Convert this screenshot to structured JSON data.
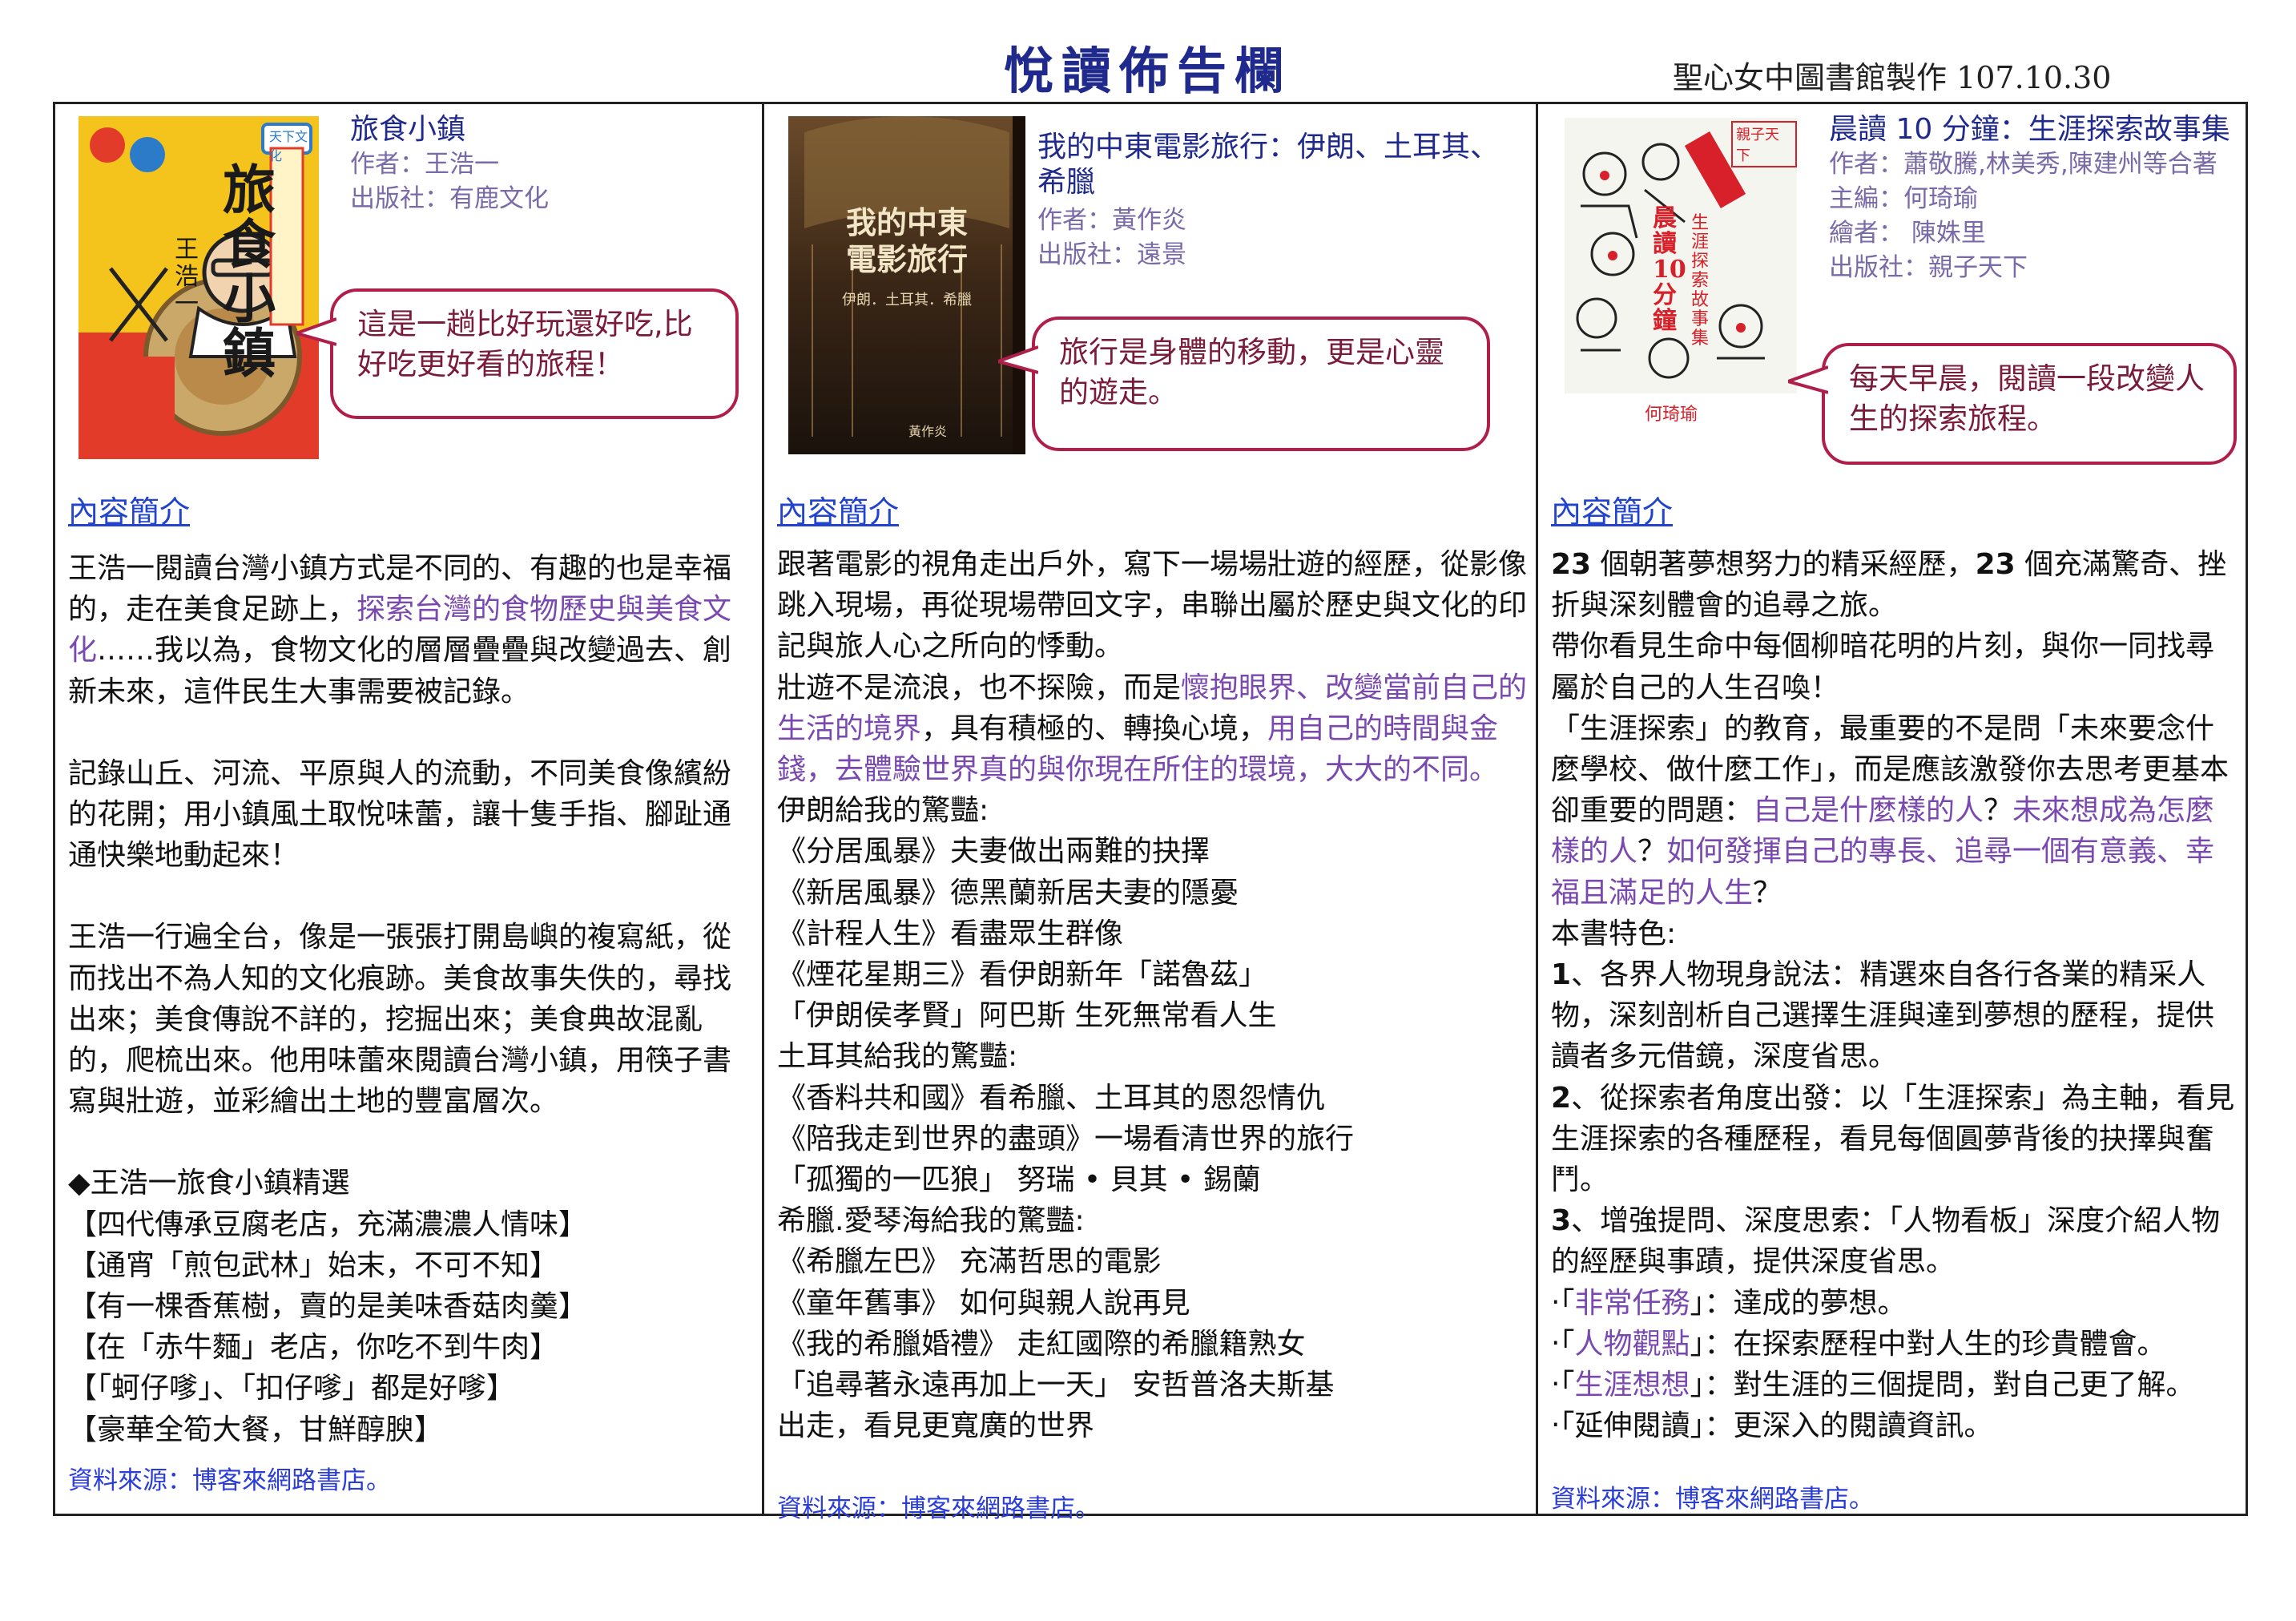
{
  "header": {
    "title": "悅讀佈告欄",
    "credit": "聖心女中圖書館製作 107.10.30"
  },
  "book1": {
    "cover": {
      "title_text": "旅食小鎮",
      "author_text": "王浩一",
      "publisher_text": "天下文化"
    },
    "title": "旅食小鎮",
    "author": "作者：王浩一",
    "publisher": "出版社：有鹿文化",
    "quote": "這是一趟比好玩還好吃,比好吃更好看的旅程！",
    "intro_label": "內容簡介",
    "body": {
      "p1a": "王浩一閱讀台灣小鎮方式是不同的、有趣的也是幸福的，走在美食足跡上，",
      "p1b": "探索台灣的食物歷史與美食文化",
      "p1c": "……我以為，食物文化的層層疊疊與改變過去、創新未來，這件民生大事需要被記錄。",
      "p2": "記錄山丘、河流、平原與人的流動，不同美食像繽紛的花開；用小鎮風土取悅味蕾，讓十隻手指、腳趾通通快樂地動起來！",
      "p3": "王浩一行遍全台，像是一張張打開島嶼的複寫紙，從而找出不為人知的文化痕跡。美食故事失佚的，尋找出來；美食傳說不詳的，挖掘出來；美食典故混亂的，爬梳出來。他用味蕾來閱讀台灣小鎮，用筷子書寫與壯遊，並彩繪出土地的豐富層次。",
      "list_title": "◆王浩一旅食小鎮精選",
      "list": [
        "【四代傳承豆腐老店，充滿濃濃人情味】",
        "【通宵「煎包武林」始末，不可不知】",
        "【有一棵香蕉樹，賣的是美味香菇肉羹】",
        "【在「赤牛麵」老店，你吃不到牛肉】",
        "【「蚵仔嗲」、「扣仔嗲」都是好嗲】",
        "【豪華全筍大餐，甘鮮醇腴】"
      ]
    },
    "source": "資料來源：博客來網路書店。"
  },
  "book2": {
    "cover": {
      "title_text": "我的中東電影旅行",
      "sub_text": "伊朗．土耳其．希臘",
      "author_text": "黃作炎"
    },
    "title": "我的中東電影旅行：伊朗、土耳其、希臘",
    "author": "作者：黃作炎",
    "publisher": "出版社：遠景",
    "quote": "旅行是身體的移動，更是心靈的遊走。",
    "intro_label": "內容簡介",
    "body": {
      "p1": "跟著電影的視角走出戶外，寫下一場場壯遊的經歷，從影像跳入現場，再從現場帶回文字，串聯出屬於歷史與文化的印記與旅人心之所向的悸動。",
      "p2a": "壯遊不是流浪，也不探險，而是",
      "p2b": "懷抱眼界、改變當前自己的生活的境界",
      "p2c": "，具有積極的、轉換心境，",
      "p2d": "用自己的時間與金錢，去體驗世界真的與你現在所住的環境，大大的不同。",
      "iran_title": "伊朗給我的驚豔:",
      "iran": [
        "《分居風暴》夫妻做出兩難的抉擇",
        "《新居風暴》德黑蘭新居夫妻的隱憂",
        "《計程人生》看盡眾生群像",
        "《煙花星期三》看伊朗新年「諾魯茲」",
        "「伊朗侯孝賢」阿巴斯  生死無常看人生"
      ],
      "turkey_title": "土耳其給我的驚豔:",
      "turkey": [
        "《香料共和國》看希臘、土耳其的恩怨情仇",
        "《陪我走到世界的盡頭》一場看清世界的旅行",
        "「孤獨的一匹狼」  努瑞 • 貝其 • 錫蘭"
      ],
      "greece_title": "希臘.愛琴海給我的驚豔:",
      "greece": [
        "《希臘左巴》  充滿哲思的電影",
        "《童年舊事》  如何與親人說再見",
        "《我的希臘婚禮》  走紅國際的希臘籍熟女",
        "「追尋著永遠再加上一天」  安哲普洛夫斯基",
        "出走，看見更寬廣的世界"
      ]
    },
    "source": "資料來源：博客來網路書店。"
  },
  "book3": {
    "cover": {
      "title_text": "晨讀10分鐘",
      "sub_text": "生涯探索故事集",
      "corner_text": "親子天下",
      "author_text": "何琦瑜"
    },
    "title": "晨讀 10 分鐘：生涯探索故事集",
    "author": "作者：蕭敬騰,林美秀,陳建州等合著",
    "editor": "主編：何琦瑜",
    "illustrator": "繪者：  陳姝里",
    "publisher": "出版社：親子天下",
    "quote": "每天早晨，閱讀一段改變人生的探索旅程。",
    "intro_label": "內容簡介",
    "body": {
      "p1_n1": "23",
      "p1a": " 個朝著夢想努力的精采經歷，",
      "p1_n2": "23",
      "p1b": " 個充滿驚奇、挫折與深刻體會的追尋之旅。",
      "p2": "帶你看見生命中每個柳暗花明的片刻，與你一同找尋屬於自己的人生召喚！",
      "p3a": "「生涯探索」的教育，最重要的不是問「未來要念什麼學校、做什麼工作」，而是應該激發你去思考更基本卻重要的問題：",
      "p3b": "自己是什麼樣的人",
      "p3c": "？",
      "p3d": "未來想成為怎麼樣的人",
      "p3e": "？",
      "p3f": "如何發揮自己的專長、追尋一個有意義、幸福且滿足的人生",
      "p3g": "？",
      "features_title": "本書特色:",
      "f1_n": "1",
      "f1": "、各界人物現身說法：精選來自各行各業的精采人物，深刻剖析自己選擇生涯與達到夢想的歷程，提供讀者多元借鏡，深度省思。",
      "f2_n": "2",
      "f2": "、從探索者角度出發：以「生涯探索」為主軸，看見生涯探索的各種歷程，看見每個圓夢背後的抉擇與奮鬥。",
      "f3_n": "3",
      "f3": "、增強提問、深度思索：「人物看板」深度介紹人物的經歷與事蹟，提供深度省思。",
      "b1a": "‧「",
      "b1b": "非常任務",
      "b1c": "」：達成的夢想。",
      "b2a": "‧「",
      "b2b": "人物觀點",
      "b2c": "」：在探索歷程中對人生的珍貴體會。",
      "b3a": "‧「",
      "b3b": "生涯想想",
      "b3c": "」：對生涯的三個提問，對自己更了解。",
      "b4": "‧「延伸閱讀」：更深入的閱讀資訊。"
    },
    "source": "資料來源：博客來網路書店。"
  }
}
